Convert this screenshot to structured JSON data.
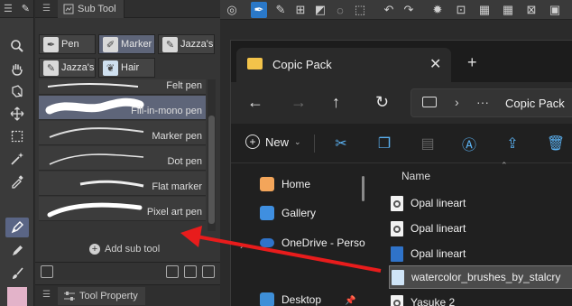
{
  "subtool_panel": {
    "tab_label": "Sub Tool",
    "groups": [
      {
        "label": "Pen",
        "selected": false
      },
      {
        "label": "Marker",
        "selected": true
      },
      {
        "label": "Jazza's",
        "selected": false
      },
      {
        "label": "Jazza's",
        "selected": false
      },
      {
        "label": "Hair",
        "selected": false
      }
    ],
    "brushes": [
      {
        "label": "Felt pen",
        "selected": false
      },
      {
        "label": "Fill-in-mono pen",
        "selected": true
      },
      {
        "label": "Marker pen",
        "selected": false
      },
      {
        "label": "Dot pen",
        "selected": false
      },
      {
        "label": "Flat marker",
        "selected": false
      },
      {
        "label": "Pixel art pen",
        "selected": false
      }
    ],
    "add_sub_tool": "Add sub tool",
    "property_tab": "Tool Property"
  },
  "explorer": {
    "tab_title": "Copic Pack",
    "address_path": "Copic Pack",
    "new_label": "New",
    "nav_items": [
      {
        "label": "Home",
        "icon": "home-icon"
      },
      {
        "label": "Gallery",
        "icon": "gallery-icon"
      },
      {
        "label": "OneDrive - Perso",
        "icon": "cloud-icon"
      },
      {
        "label": "Desktop",
        "icon": "desktop-icon"
      }
    ],
    "column_header": "Name",
    "files": [
      {
        "name": "Opal lineart",
        "icon": "file-icon",
        "selected": false
      },
      {
        "name": "Opal lineart",
        "icon": "file-icon",
        "selected": false
      },
      {
        "name": "Opal lineart",
        "icon": "clip-file-icon",
        "selected": false
      },
      {
        "name": "watercolor_brushes_by_stalcry",
        "icon": "brush-file-icon",
        "selected": true
      },
      {
        "name": "Yasuke 2",
        "icon": "file-icon",
        "selected": false
      }
    ]
  },
  "colors": {
    "accent_blue": "#2a78c8",
    "selection": "#5e6579",
    "arrow_red": "#e81c1c",
    "folder_yellow": "#f3c34a"
  }
}
